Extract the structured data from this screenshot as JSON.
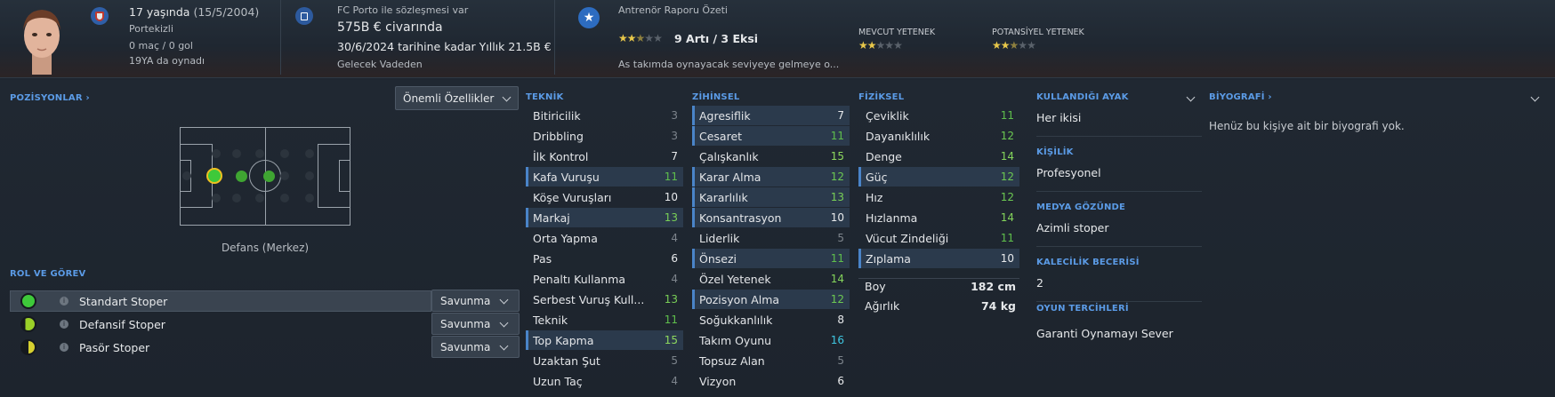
{
  "header": {
    "age": "17 yaşında",
    "dob": "(15/5/2004)",
    "nationality": "Portekizli",
    "apps": "0 maç / 0 gol",
    "played_at": "19YA da oynadı",
    "contract_label": "FC Porto ile sözleşmesi var",
    "value": "575B € civarında",
    "wage": "30/6/2024 tarihine kadar Yıllık 21.5B €",
    "future": "Gelecek Vadeden",
    "report_title": "Antrenör Raporu Özeti",
    "report_summary": "9 Artı / 3 Eksi",
    "report_text": "As takımda oynayacak seviyeye gelmeye o...",
    "current_ability_label": "MEVCUT YETENEK",
    "potential_ability_label": "POTANSİYEL YETENEK",
    "report_stars": 2.5,
    "current_stars": 2,
    "potential_stars": 2.5
  },
  "positions": {
    "title": "POZİSYONLAR",
    "dropdown": "Önemli Özellikler",
    "position_name": "Defans (Merkez)"
  },
  "roles": {
    "title": "ROL VE GÖREV",
    "items": [
      {
        "name": "Standart Stoper",
        "duty": "Savunma"
      },
      {
        "name": "Defansif Stoper",
        "duty": "Savunma"
      },
      {
        "name": "Pasör Stoper",
        "duty": "Savunma"
      }
    ]
  },
  "technical": {
    "title": "TEKNİK",
    "items": [
      {
        "label": "Bitiricilik",
        "value": "3"
      },
      {
        "label": "Dribbling",
        "value": "3"
      },
      {
        "label": "İlk Kontrol",
        "value": "7"
      },
      {
        "label": "Kafa Vuruşu",
        "value": "11"
      },
      {
        "label": "Köşe Vuruşları",
        "value": "10"
      },
      {
        "label": "Markaj",
        "value": "13"
      },
      {
        "label": "Orta Yapma",
        "value": "4"
      },
      {
        "label": "Pas",
        "value": "6"
      },
      {
        "label": "Penaltı Kullanma",
        "value": "4"
      },
      {
        "label": "Serbest Vuruş Kull...",
        "value": "13"
      },
      {
        "label": "Teknik",
        "value": "11"
      },
      {
        "label": "Top Kapma",
        "value": "15"
      },
      {
        "label": "Uzaktan Şut",
        "value": "5"
      },
      {
        "label": "Uzun Taç",
        "value": "4"
      }
    ]
  },
  "mental": {
    "title": "ZİHİNSEL",
    "items": [
      {
        "label": "Agresiflik",
        "value": "7"
      },
      {
        "label": "Cesaret",
        "value": "11"
      },
      {
        "label": "Çalışkanlık",
        "value": "15"
      },
      {
        "label": "Karar Alma",
        "value": "12"
      },
      {
        "label": "Kararlılık",
        "value": "13"
      },
      {
        "label": "Konsantrasyon",
        "value": "10"
      },
      {
        "label": "Liderlik",
        "value": "5"
      },
      {
        "label": "Önsezi",
        "value": "11"
      },
      {
        "label": "Özel Yetenek",
        "value": "14"
      },
      {
        "label": "Pozisyon Alma",
        "value": "12"
      },
      {
        "label": "Soğukkanlılık",
        "value": "8"
      },
      {
        "label": "Takım Oyunu",
        "value": "16"
      },
      {
        "label": "Topsuz Alan",
        "value": "5"
      },
      {
        "label": "Vizyon",
        "value": "6"
      }
    ]
  },
  "physical": {
    "title": "FİZİKSEL",
    "items": [
      {
        "label": "Çeviklik",
        "value": "11"
      },
      {
        "label": "Dayanıklılık",
        "value": "12"
      },
      {
        "label": "Denge",
        "value": "14"
      },
      {
        "label": "Güç",
        "value": "12"
      },
      {
        "label": "Hız",
        "value": "12"
      },
      {
        "label": "Hızlanma",
        "value": "14"
      },
      {
        "label": "Vücut Zindeliği",
        "value": "11"
      },
      {
        "label": "Zıplama",
        "value": "10"
      }
    ],
    "height_label": "Boy",
    "height": "182 cm",
    "weight_label": "Ağırlık",
    "weight": "74 kg"
  },
  "info": {
    "foot_title": "KULLANDIĞI AYAK",
    "foot": "Her ikisi",
    "personality_title": "KİŞİLİK",
    "personality": "Profesyonel",
    "media_title": "MEDYA GÖZÜNDE",
    "media": "Azimli stoper",
    "gk_title": "KALECİLİK BECERİSİ",
    "gk": "2",
    "pref_title": "OYUN TERCİHLERİ",
    "pref": "Garanti Oynamayı Sever"
  },
  "bio": {
    "title": "BİYOGRAFİ",
    "text": "Henüz bu kişiye ait bir biyografi yok."
  }
}
